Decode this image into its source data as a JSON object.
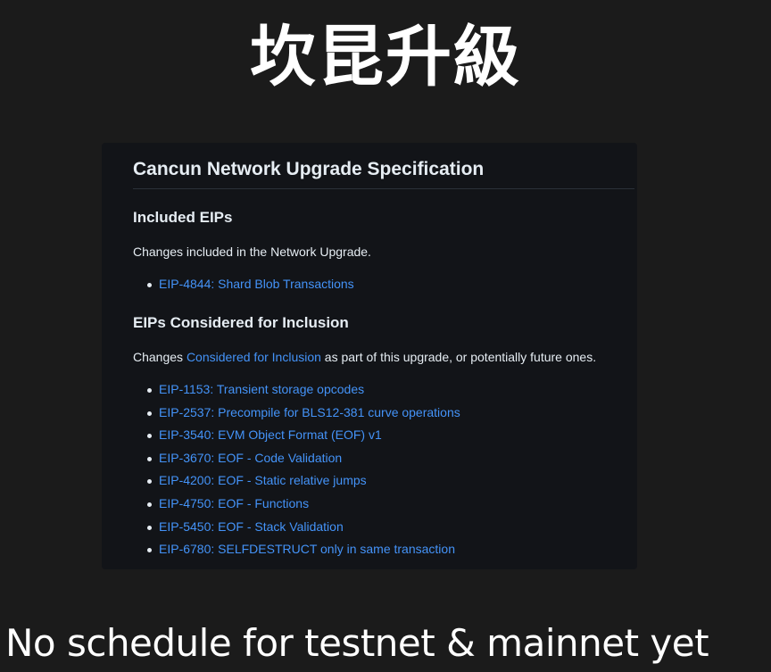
{
  "title": "坎昆升級",
  "doc": {
    "heading": "Cancun Network Upgrade Specification",
    "included": {
      "heading": "Included EIPs",
      "description": "Changes included in the Network Upgrade.",
      "items": [
        "EIP-4844: Shard Blob Transactions"
      ]
    },
    "considered": {
      "heading": "EIPs Considered for Inclusion",
      "description_prefix": "Changes ",
      "description_link": "Considered for Inclusion",
      "description_suffix": " as part of this upgrade, or potentially future ones.",
      "items": [
        "EIP-1153: Transient storage opcodes",
        "EIP-2537: Precompile for BLS12-381 curve operations",
        "EIP-3540: EVM Object Format (EOF) v1",
        "EIP-3670: EOF - Code Validation",
        "EIP-4200: EOF - Static relative jumps",
        "EIP-4750: EOF - Functions",
        "EIP-5450: EOF - Stack Validation",
        "EIP-6780: SELFDESTRUCT only in same transaction"
      ]
    }
  },
  "caption": "No schedule for testnet & mainnet yet",
  "colors": {
    "background": "#1b1b1b",
    "panel": "#121418",
    "link": "#4493f8",
    "text": "#e6edf3"
  }
}
